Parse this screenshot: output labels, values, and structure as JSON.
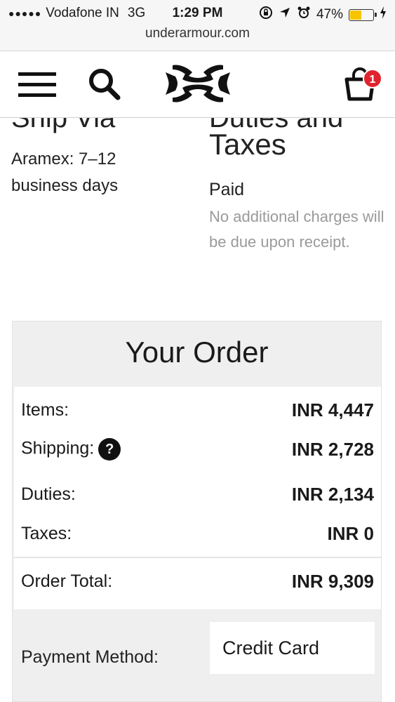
{
  "status_bar": {
    "signal_dots": "●●●●●",
    "carrier": "Vodafone IN",
    "network": "3G",
    "time": "1:29 PM",
    "icons": [
      "rotation-lock-icon",
      "location-arrow-icon",
      "alarm-icon"
    ],
    "battery_percent": "47%",
    "battery_level": 0.47,
    "battery_color": "#f7c400",
    "url": "underarmour.com"
  },
  "navbar": {
    "icons": [
      "menu-icon",
      "search-icon",
      "under-armour-logo",
      "shopping-bag-icon"
    ],
    "cart_count": "1",
    "badge_color": "#e0232f"
  },
  "shipping": {
    "heading_cutoff": "Ship Via",
    "method": "Aramex: 7–12",
    "eta": "business days"
  },
  "duties": {
    "heading_cutoff": "Duties and",
    "heading": "Taxes",
    "status": "Paid",
    "note": "No additional charges will be due upon receipt."
  },
  "order": {
    "title": "Your Order",
    "rows": [
      {
        "label": "Items:",
        "value": "INR 4,447"
      },
      {
        "label": "Shipping:",
        "value": "INR 2,728"
      },
      {
        "label": "Duties:",
        "value": "INR 2,134"
      },
      {
        "label": "Taxes:",
        "value": "INR 0"
      }
    ],
    "total_label": "Order Total:",
    "total_value": "INR 9,309",
    "payment_label": "Payment Method:",
    "payment_value": "Credit Card"
  }
}
